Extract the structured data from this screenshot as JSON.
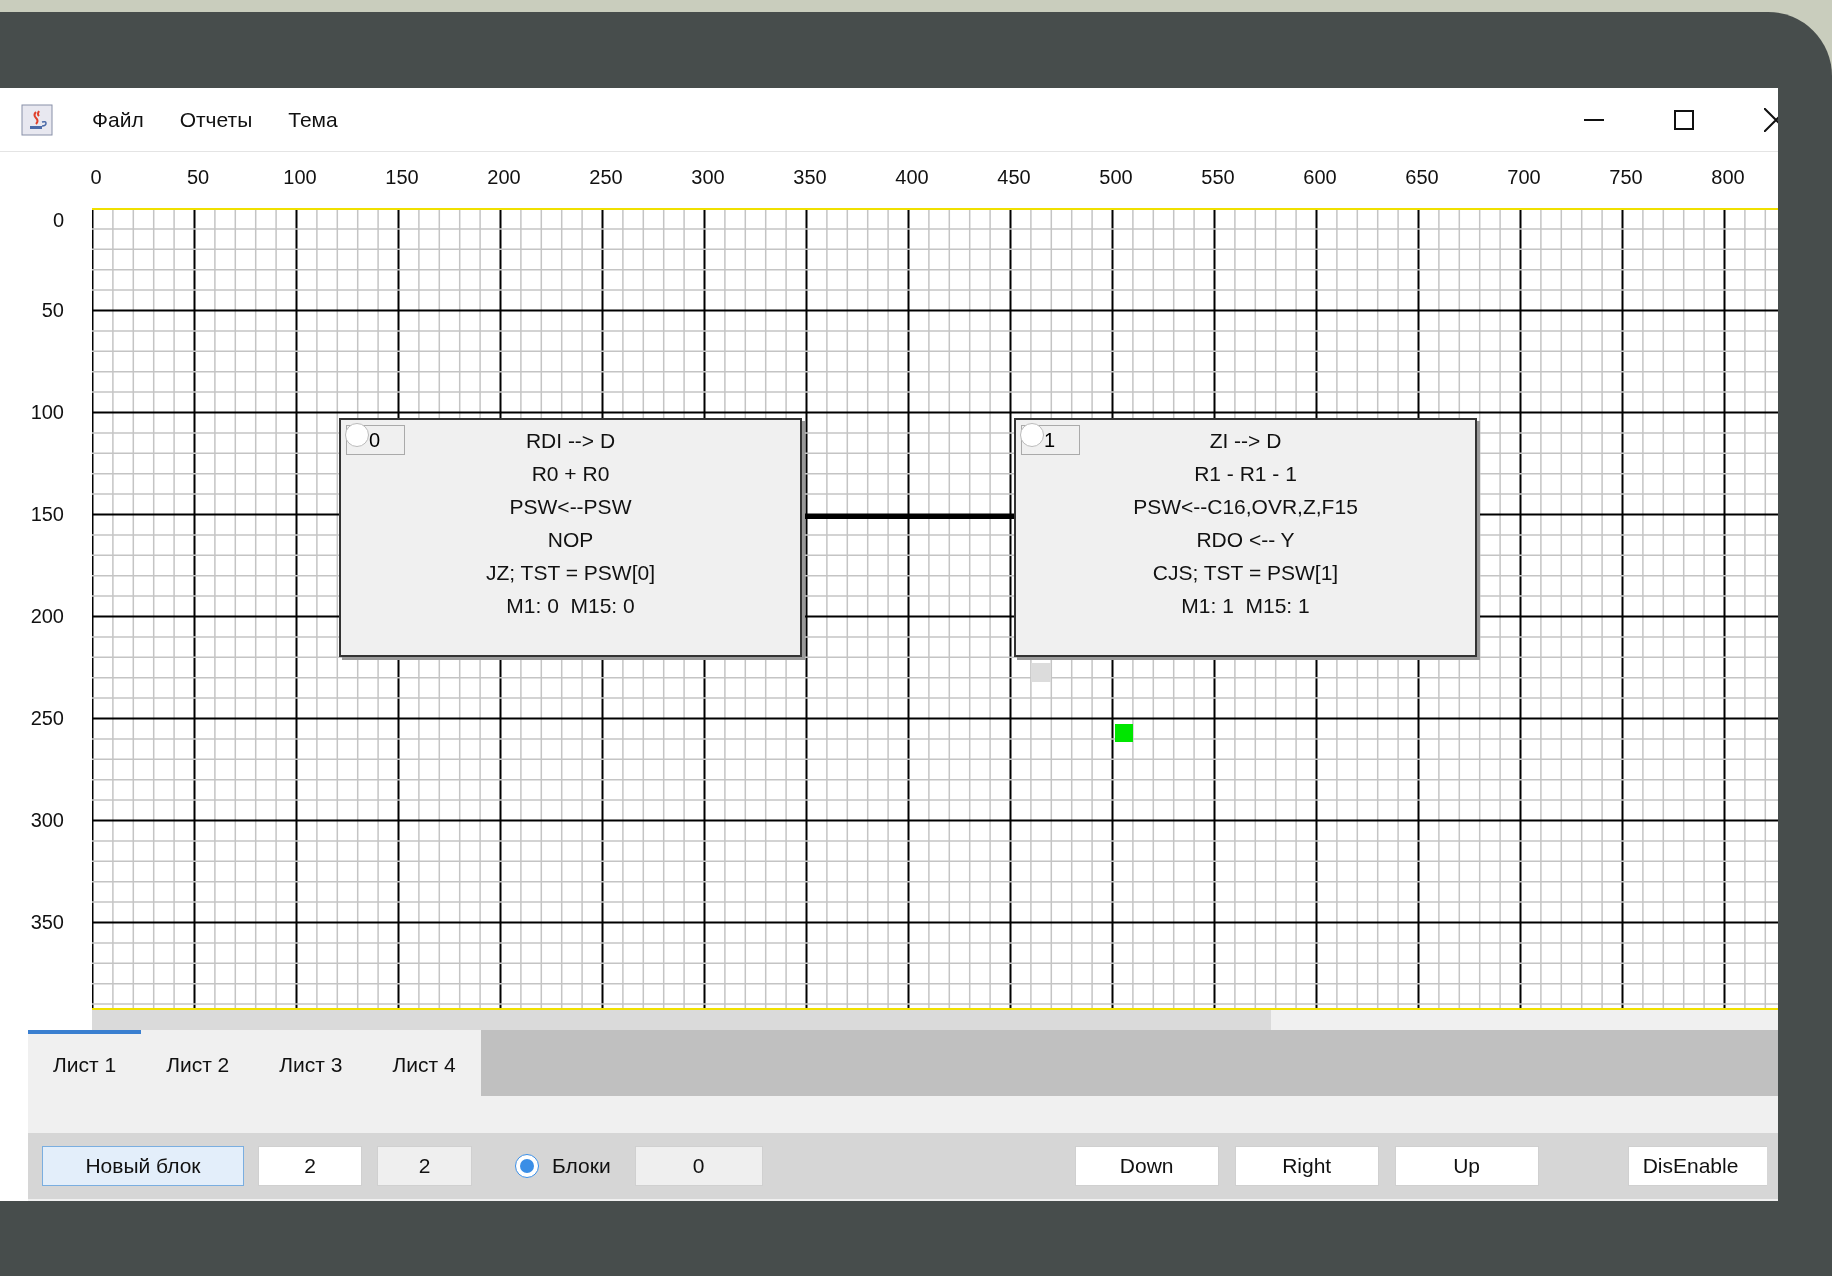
{
  "window": {
    "menu": [
      "Файл",
      "Отчеты",
      "Тема"
    ]
  },
  "ruler": {
    "x_labels": [
      "0",
      "50",
      "100",
      "150",
      "200",
      "250",
      "300",
      "350",
      "400",
      "450",
      "500",
      "550",
      "600",
      "650",
      "700",
      "750",
      "800"
    ],
    "y_labels": [
      "0",
      "50",
      "100",
      "150",
      "200",
      "250",
      "300",
      "350"
    ]
  },
  "blocks": [
    {
      "number": "0",
      "lines": [
        "RDI --> D",
        "R0 + R0",
        "PSW<--PSW",
        "NOP",
        "JZ; TST = PSW[0]",
        "M1: 0  M15: 0"
      ]
    },
    {
      "number": "1",
      "lines": [
        "ZI --> D",
        "R1 - R1 - 1",
        "PSW<--C16,OVR,Z,F15",
        "RDO <-- Y",
        "CJS; TST = PSW[1]",
        "M1: 1  M15: 1"
      ]
    }
  ],
  "tabs": [
    {
      "label": "Лист 1",
      "selected": true
    },
    {
      "label": "Лист 2",
      "selected": false
    },
    {
      "label": "Лист 3",
      "selected": false
    },
    {
      "label": "Лист 4",
      "selected": false
    }
  ],
  "toolbar": {
    "new_block_button": "Новый блок",
    "fields": [
      {
        "value": "2",
        "disabled": false
      },
      {
        "value": "2",
        "disabled": true
      }
    ],
    "radio": {
      "label": "Блоки",
      "checked": true
    },
    "counter_field": {
      "value": "0",
      "disabled": true
    },
    "buttons": [
      "Down",
      "Right",
      "Up",
      "DisEnable"
    ]
  }
}
